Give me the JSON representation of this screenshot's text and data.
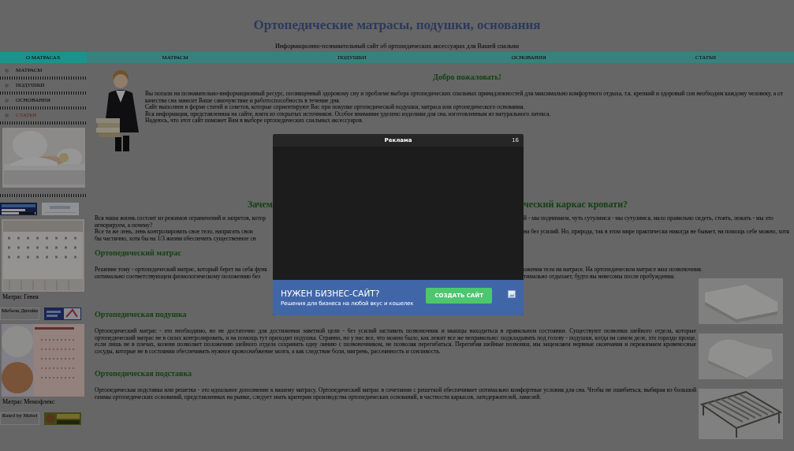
{
  "header": {
    "title": "Ортопедические матрасы, подушки, основания",
    "tagline": "Информационно-познавательный сайт об ортопедических аксессуарах для Вашей спальни"
  },
  "nav": [
    {
      "label": "О МАТРАСАХ",
      "selected": true
    },
    {
      "label": "МАТРАСЫ",
      "selected": false
    },
    {
      "label": "ПОДУШКИ",
      "selected": false
    },
    {
      "label": "ОСНОВАНИЯ",
      "selected": false
    },
    {
      "label": "СТАТЬИ",
      "selected": false
    }
  ],
  "sidebar": {
    "menu": [
      {
        "label": "МАТРАСЫ",
        "selected": false
      },
      {
        "label": "ПОДУШКИ",
        "selected": false
      },
      {
        "label": "ОСНОВАНИЯ",
        "selected": false
      },
      {
        "label": "СТАТЬИ",
        "selected": true
      }
    ],
    "blocks": [
      {
        "kind": "banners",
        "banners": [
          {
            "kind": "counter"
          },
          {
            "kind": "light"
          }
        ]
      },
      {
        "caption": "Матрас Гевея"
      },
      {
        "kind": "banners",
        "banners": [
          {
            "kind": "alt",
            "text": "Мебель Дизайн"
          },
          {
            "kind": "logo"
          }
        ]
      },
      {
        "caption": "Матрас Мемофлекс"
      },
      {
        "kind": "banners",
        "banners": [
          {
            "kind": "alt",
            "text": "Rated by Mebel"
          },
          {
            "kind": "gold"
          }
        ]
      }
    ]
  },
  "welcome": {
    "heading": "Добро пожаловать!",
    "paragraphs": [
      "Вы попали на познавательно-информационный ресурс, посвященный здоровому сну и проблеме выбора ортопедических спальных принадлежностей для максимально комфортного отдыха, т.к. крепкий и здоровый сон необходим каждому человеку, а от качества сна зависит Ваше самочувствие и работоспособность в течение дня.",
      "Сайт выполнен в форме статей и советов, которые сориентируют Вас при покупке ортопедической подушки, матраса или ортопедического основания.",
      "Вся информация, представленная на сайте, взята из открытых источников. Особое внимание уделено изделиям для сна, изготовленным из натурального латекса.",
      "Надеюсь, что этот сайт поможет Вам в выборе ортопедических спальных аксессуаров."
    ]
  },
  "why": {
    "heading_left": "Зачем",
    "heading_right": "ческий каркас кровати?",
    "lines": [
      {
        "left": "Вся наша жизнь состоит из режимов ограничений и запретов, котор",
        "right": "й - мы поднимаем, чуть сутулимся - мы сутулимся, мало правильно сидеть, стоять, лежать - мы это"
      },
      {
        "left": "игнорируем, а почему?"
      },
      {
        "left": "Все та же лень, лень контролировать свое тело, напрягать свои",
        "right": "на без усилий. Но, природа, так в этом мире практически никогда не бывает, на помощь себе можно, хотя"
      },
      {
        "left": "бы частично, хотя бы на 1/3 жизни обеспечить существенное сн"
      }
    ]
  },
  "mattress": {
    "heading": "Ортопедический матрас",
    "lines": [
      {
        "left": "Решение тому - ортопедический матрас, который берет на себя функ",
        "right": "ожения тела на матрасе. На ортопедическом матрасе ваш позвоночник"
      },
      {
        "left": "оптимально соответствующем физиологическому положению без",
        "right": "тимально отдыхает, будто вы невесомы после пробуждения."
      }
    ]
  },
  "pillow": {
    "heading": "Ортопедическая подушка",
    "text": "Ортопедический матрас - это необходимо, но не достаточно для достижения заветной цели - без усилий заставить позвоночник и мышцы находиться в правильном состоянии. Существуют позвонки шейного отдела, которые ортопедический матрас не в силах контролировать, и на помощь тут приходит подушка. Странно, но у нас все, что можно было, как лежит все же неправильно: подкладывать под голову - подушки, когда на самом деле, это гораздо проще, если лишь не в плечах, колени позволяет положению шейного отдела сохранить одну линию с позвоночником, не позволяя перегибаться. Перегибая шейные позвонки, мы защемляем нервные окончания и пережимаем кровеносные сосуды, которые не в состоянии обеспечивать нужное кровоснабжение мозга, а как следствие боли, мигрень, рассеянность и сонливость."
  },
  "base": {
    "heading": "Ортопедическая подставка",
    "text": "Ортопедическая подставка или решетка - это идеальное дополнение к вашему матрасу. Ортопедический матрас в сочетании с решеткой обеспечивает оптимально комфортные условия для сна. Чтобы не ошибиться, выбирая из большой гаммы ортопедических оснований, представленных на рынке, следует знать критерии производства ортопедических оснований, в частности каркасов, латодержателей, ламелей."
  },
  "ad": {
    "title": "Реклама",
    "countdown": "16",
    "headline": "НУЖЕН БИЗНЕС-САЙТ?",
    "subline": "Решения для бизнеса на любой вкус и кошелек",
    "button": "СОЗДАТЬ САЙТ"
  }
}
